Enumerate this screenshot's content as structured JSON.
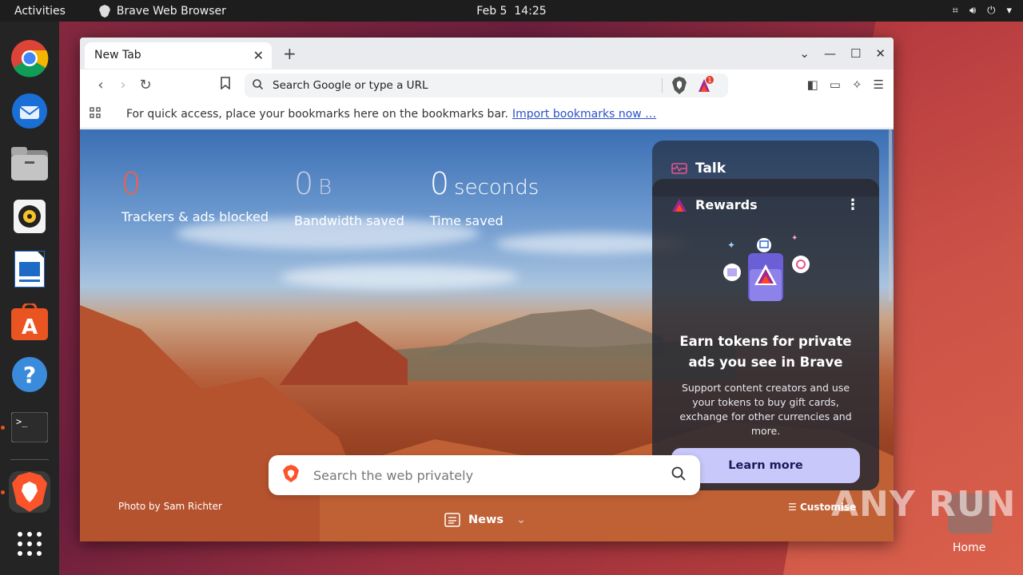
{
  "topbar": {
    "activities": "Activities",
    "app_name": "Brave Web Browser",
    "date": "Feb 5",
    "time": "14:25"
  },
  "dock": {
    "items": [
      "chrome-icon",
      "thunderbird-icon",
      "files-icon",
      "rhythmbox-icon",
      "writer-icon",
      "app-center-icon",
      "help-icon",
      "terminal-icon",
      "brave-icon"
    ]
  },
  "browser": {
    "tab_title": "New Tab",
    "url_placeholder": "Search Google or type a URL",
    "rewards_badge_count": "1",
    "bookmarks_bar_text": "For quick access, place your bookmarks here on the bookmarks bar.",
    "import_link": "Import bookmarks now …"
  },
  "stats": {
    "trackers_value": "0",
    "trackers_label": "Trackers & ads blocked",
    "bandwidth_value": "0",
    "bandwidth_unit": "B",
    "bandwidth_label": "Bandwidth saved",
    "time_value": "0",
    "time_unit": "seconds",
    "time_label": "Time saved"
  },
  "panel": {
    "talk_label": "Talk",
    "rewards_label": "Rewards",
    "rewards_title": "Earn tokens for private ads you see in Brave",
    "rewards_desc": "Support content creators and use your tokens to buy gift cards, exchange for other currencies and more.",
    "learn_more": "Learn more"
  },
  "search": {
    "placeholder": "Search the web privately"
  },
  "footer": {
    "photo_credit": "Photo by Sam Richter",
    "news_label": "News",
    "customise_label": "Customise"
  },
  "desktop": {
    "home_label": "Home",
    "watermark": "ANY RUN"
  },
  "colors": {
    "trackers_accent": "#ff5d3a",
    "learn_btn_bg": "#c9c8fa",
    "link": "#2b50c8"
  }
}
